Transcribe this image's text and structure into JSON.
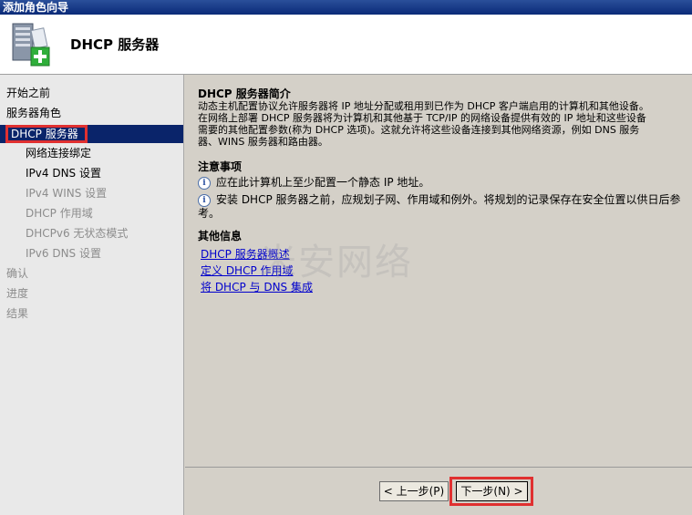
{
  "window": {
    "title": "添加角色向导"
  },
  "header": {
    "title": "DHCP  服务器"
  },
  "sidebar": {
    "items": [
      {
        "label": "开始之前"
      },
      {
        "label": "服务器角色"
      },
      {
        "label": "DHCP 服务器"
      },
      {
        "label": "网络连接绑定"
      },
      {
        "label": "IPv4 DNS 设置"
      },
      {
        "label": "IPv4 WINS 设置"
      },
      {
        "label": "DHCP 作用域"
      },
      {
        "label": "DHCPv6 无状态模式"
      },
      {
        "label": "IPv6 DNS 设置"
      },
      {
        "label": "确认"
      },
      {
        "label": "进度"
      },
      {
        "label": "结果"
      }
    ]
  },
  "main": {
    "intro_heading": "DHCP  服务器简介",
    "intro_lines": [
      "动态主机配置协议允许服务器将 IP 地址分配或租用到已作为 DHCP 客户端启用的计算机和其他设备。",
      "在网络上部署 DHCP 服务器将为计算机和其他基于 TCP/IP 的网络设备提供有效的 IP 地址和这些设备",
      "需要的其他配置参数(称为 DHCP 选项)。这就允许将这些设备连接到其他网络资源，例如 DNS 服务",
      "器、WINS 服务器和路由器。"
    ],
    "notes_heading": "注意事项",
    "notes": [
      "应在此计算机上至少配置一个静态 IP 地址。",
      "安装 DHCP 服务器之前，应规划子网、作用域和例外。将规划的记录保存在安全位置以供日后参考。"
    ],
    "more_heading": "其他信息",
    "links": [
      "DHCP 服务器概述",
      "定义 DHCP 作用域",
      "将 DHCP 与 DNS 集成"
    ],
    "watermark": "米安网络"
  },
  "footer": {
    "back_label": "< 上一步(P)",
    "next_label": "下一步(N) >"
  }
}
